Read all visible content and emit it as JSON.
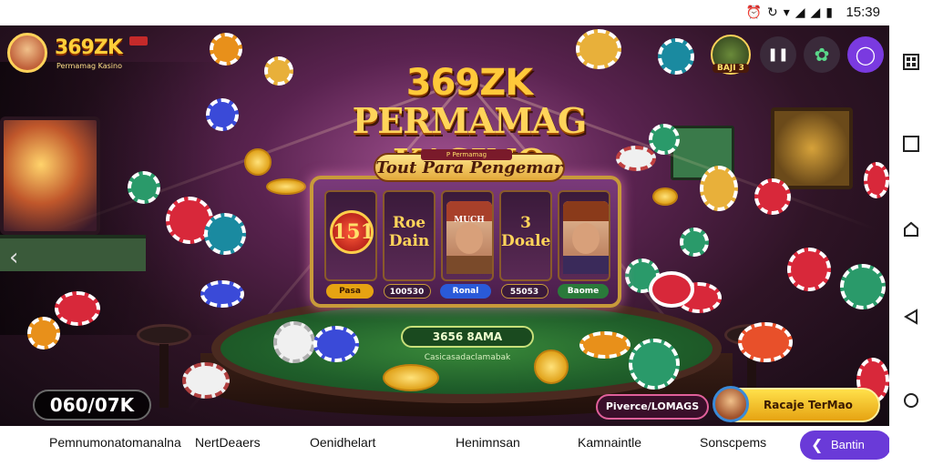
{
  "status_bar": {
    "time": "15:39",
    "icons": [
      "alarm-icon",
      "sync-icon",
      "wifi-icon",
      "signal-icon",
      "signal-icon",
      "battery-icon"
    ]
  },
  "brand": {
    "logo_text": "369ZK",
    "logo_badge": "",
    "logo_subtitle": "Permamag Kasino"
  },
  "hero": {
    "logo_369": "369ZK",
    "title": "PERMAMAG KASINO",
    "subtitle": "Tout Para Pengemar",
    "ribbon": "P Permamag"
  },
  "slot": {
    "reels": [
      {
        "type": "badge",
        "text": "151"
      },
      {
        "type": "text",
        "text": "Roe Dain"
      },
      {
        "type": "portrait",
        "text": "MUCH"
      },
      {
        "type": "text",
        "text": "3 Doale"
      },
      {
        "type": "portrait",
        "text": ""
      }
    ],
    "buttons": [
      {
        "label": "Pasa",
        "color": "#e6a312"
      },
      {
        "label": "100530",
        "color": "#3a1a3a"
      },
      {
        "label": "Ronal",
        "color": "#2a5ad8"
      },
      {
        "label": "55053",
        "color": "#3a1a3a"
      },
      {
        "label": "Baome",
        "color": "#2a7a3a"
      }
    ]
  },
  "table": {
    "label": "3656 8AMA",
    "sublabel": "Casicasadaclamabak"
  },
  "header_right": {
    "reward_label": "BAJI 3",
    "icons": [
      "bars-icon",
      "settings-icon",
      "profile-icon"
    ]
  },
  "balance": "060/07K",
  "promo_button": "Piverce/LOMAGS",
  "play_button": "Racaje TerMao",
  "bottom_nav": {
    "items": [
      "Pemnumonatomanalna",
      "NertDeaers",
      "Oenidhelart",
      "Henimnsan",
      "Kamnaintle",
      "Sonscpems"
    ],
    "primary": "Bantin"
  },
  "colors": {
    "accent_gold": "#ffc93a",
    "primary_purple": "#6a3ad8",
    "felt_green": "#1f5e2a"
  }
}
